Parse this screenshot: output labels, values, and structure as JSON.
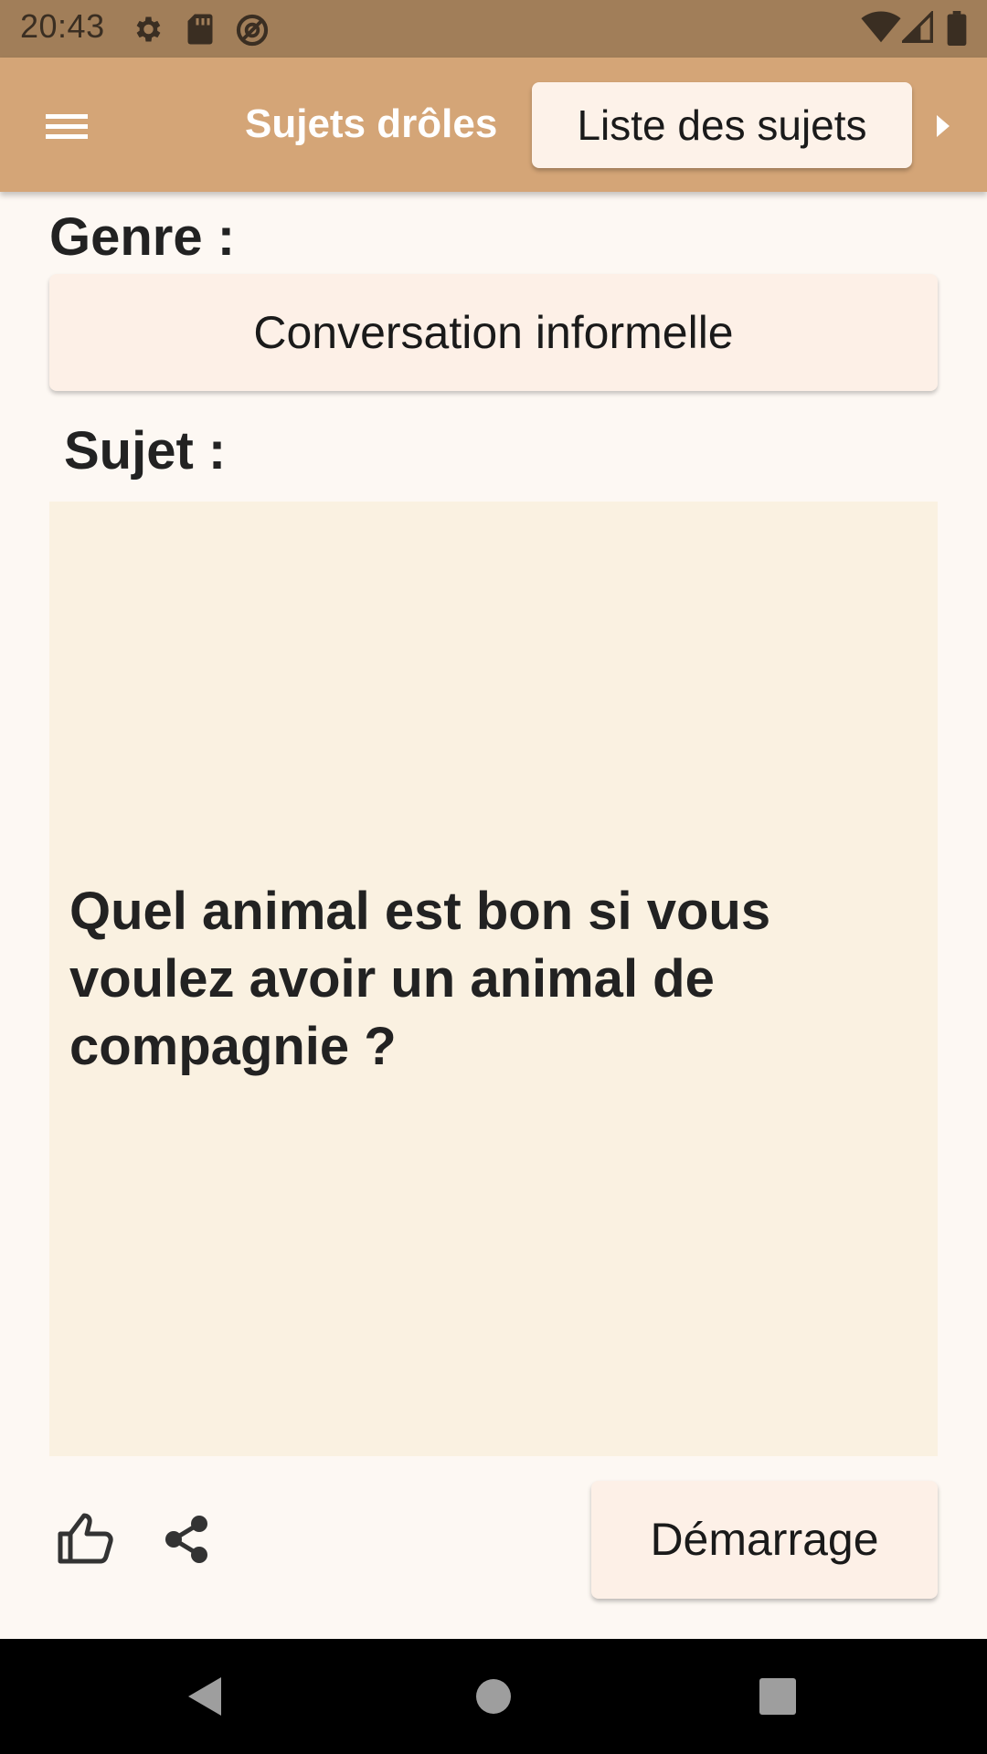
{
  "status_bar": {
    "time": "20:43",
    "left_icons": [
      "gear-icon",
      "sd-card-icon",
      "at-sign-icon"
    ],
    "right_icons": [
      "wifi-icon",
      "cell-signal-icon",
      "battery-icon"
    ]
  },
  "app_bar": {
    "menu_icon": "hamburger-menu-icon",
    "title": "Sujets drôles",
    "list_button_label": "Liste des sujets",
    "overflow_icon": "arrow-right-icon"
  },
  "genre": {
    "label": "Genre :",
    "value": "Conversation informelle"
  },
  "subject": {
    "label": "Sujet :",
    "text": "Quel animal est bon si vous voulez avoir un animal de compagnie ?"
  },
  "actions": {
    "like_icon": "thumbs-up-icon",
    "share_icon": "share-icon",
    "start_label": "Démarrage"
  },
  "nav_bar": {
    "back_icon": "back-triangle-icon",
    "home_icon": "home-circle-icon",
    "recents_icon": "recents-square-icon"
  },
  "colors": {
    "status_bar": "#a17e59",
    "app_bar": "#d4a577",
    "background": "#fdf8f3",
    "button": "#fdf0e7",
    "topic_card": "#faf1e1"
  }
}
